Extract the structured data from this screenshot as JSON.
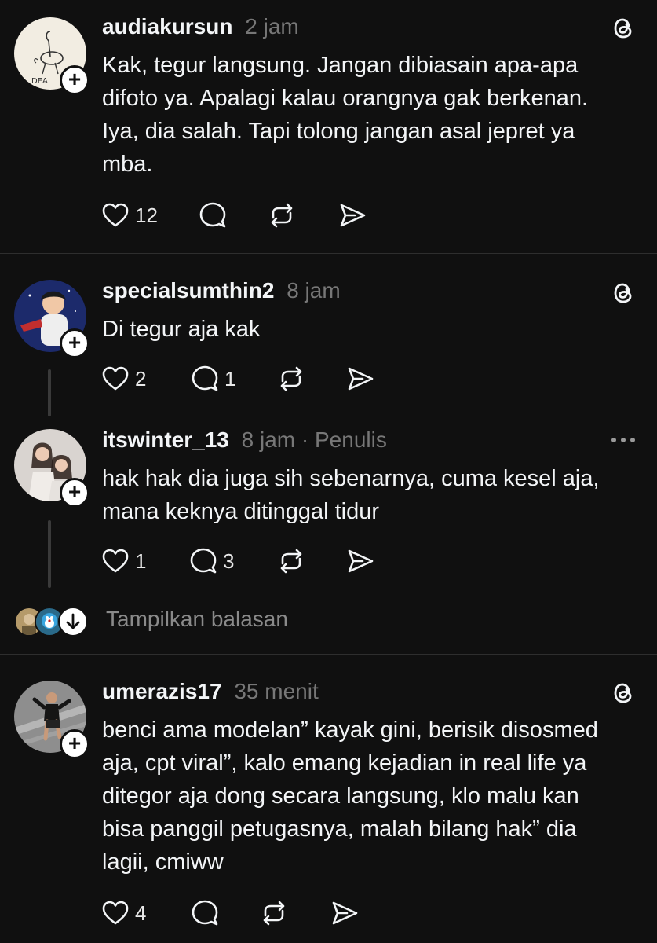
{
  "posts": [
    {
      "username": "audiakursun",
      "time": "2 jam",
      "avatar_text": "DEA",
      "text": "Kak, tegur langsung. Jangan dibiasain apa-apa\ndifoto ya. Apalagi kalau orangnya gak berkenan.\nIya, dia salah. Tapi tolong jangan asal jepret ya\nmba.",
      "likes": "12",
      "replies": ""
    },
    {
      "username": "specialsumthin2",
      "time": "8 jam",
      "text": "Di tegur aja kak",
      "likes": "2",
      "replies": "1"
    },
    {
      "username": "itswinter_13",
      "time": "8 jam",
      "role": "· Penulis",
      "text": "hak hak dia juga sih sebenarnya, cuma kesel aja,\nmana keknya ditinggal tidur",
      "likes": "1",
      "replies": "3"
    },
    {
      "username": "umerazis17",
      "time": "35 menit",
      "text": "benci ama modelan” kayak gini, berisik disosmed\naja, cpt viral”, kalo emang kejadian in real life ya\nditegor aja dong secara langsung, klo malu kan\nbisa panggil petugasnya, malah bilang hak” dia\nlagii, cmiww",
      "likes": "4",
      "replies": ""
    }
  ],
  "show_replies_label": "Tampilkan balasan",
  "icons": {
    "like": "heart-icon",
    "reply": "comment-icon",
    "repost": "repost-icon",
    "share": "send-icon",
    "threads": "threads-logo-icon",
    "more": "more-icon",
    "follow": "plus-icon",
    "expand": "arrow-down-icon"
  },
  "colors": {
    "background": "#101010",
    "text": "#f3f5f7",
    "muted": "#777777",
    "divider": "#2e2e2e"
  }
}
